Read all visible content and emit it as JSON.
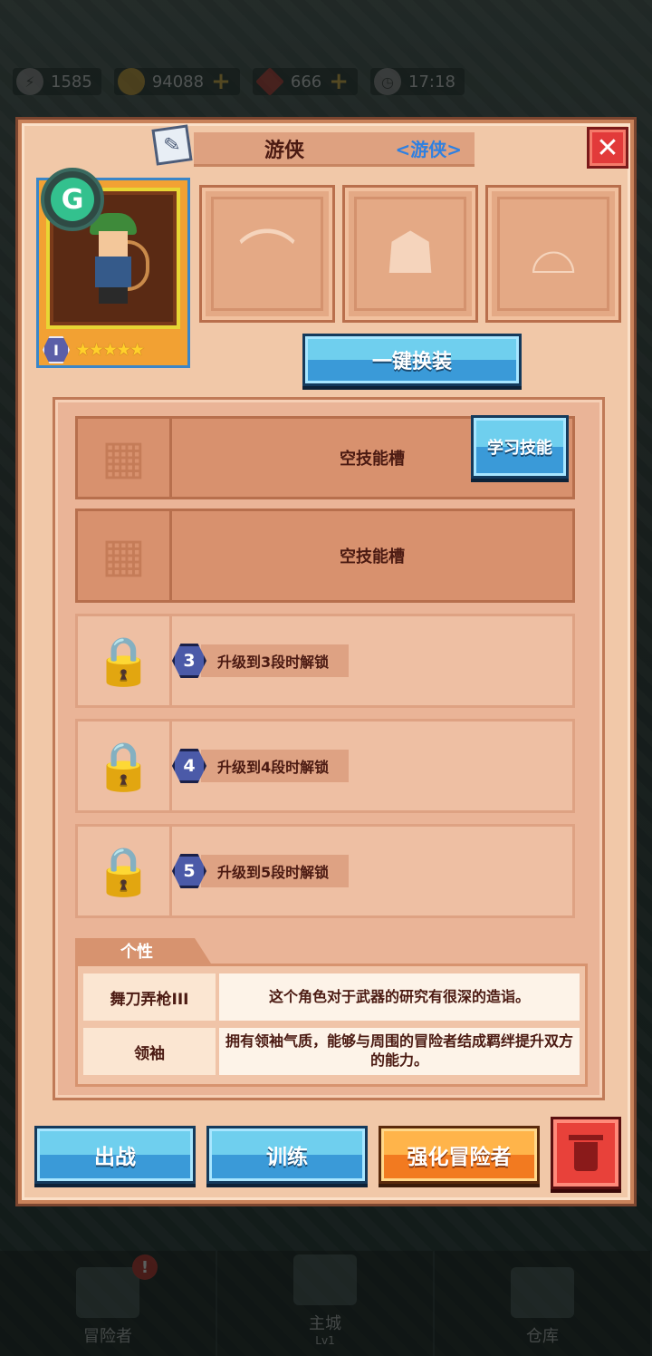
{
  "background": {
    "resources": [
      {
        "icon": "energy-icon",
        "value": "1585"
      },
      {
        "icon": "gold-coin-icon",
        "value": "94088"
      },
      {
        "icon": "red-gem-icon",
        "value": "666"
      }
    ],
    "clock": "17:18",
    "nav": [
      {
        "label": "冒险者",
        "sub": ""
      },
      {
        "label": "主城",
        "sub": "Lv1"
      },
      {
        "label": "仓库",
        "sub": ""
      }
    ],
    "nav_alert": "!"
  },
  "dialog": {
    "hero_name": "游侠",
    "hero_class": "<游侠>",
    "close_glyph": "✕",
    "grade": "G",
    "level": "I",
    "stars": "★★★★★",
    "equip_slots": [
      {
        "icon": "bow-icon"
      },
      {
        "icon": "armor-icon"
      },
      {
        "icon": "boots-icon"
      }
    ],
    "one_click_equip": "一键换装",
    "skills": {
      "empty_slot_label": "空技能槽",
      "learn_button": "学习技能",
      "locked": [
        {
          "num": "3",
          "text": "升级到3段时解锁"
        },
        {
          "num": "4",
          "text": "升级到4段时解锁"
        },
        {
          "num": "5",
          "text": "升级到5段时解锁"
        }
      ]
    },
    "traits": {
      "tab": "个性",
      "items": [
        {
          "name": "舞刀弄枪III",
          "desc": "这个角色对于武器的研究有很深的造诣。"
        },
        {
          "name": "领袖",
          "desc": "拥有领袖气质，能够与周围的冒险者结成羁绊提升双方的能力。"
        }
      ]
    },
    "buttons": {
      "deploy": "出战",
      "train": "训练",
      "enhance": "强化冒险者"
    }
  },
  "colors": {
    "panel": "#f1c8a8",
    "accent_blue": "#3a9ad8",
    "accent_orange": "#f27a20",
    "danger": "#e23a3a",
    "class_text": "#2f80e0"
  }
}
